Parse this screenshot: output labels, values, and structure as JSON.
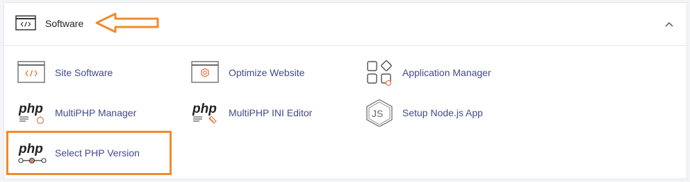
{
  "section": {
    "title": "Software",
    "icons": {
      "header": "code-window-icon",
      "collapse": "chevron-up-icon"
    }
  },
  "items": [
    {
      "label": "Site Software",
      "icon": "code-window-icon"
    },
    {
      "label": "Optimize Website",
      "icon": "gear-window-icon"
    },
    {
      "label": "Application Manager",
      "icon": "apps-grid-icon"
    },
    {
      "label": "MultiPHP Manager",
      "icon": "php-gear-icon"
    },
    {
      "label": "MultiPHP INI Editor",
      "icon": "php-editor-icon"
    },
    {
      "label": "Setup Node.js App",
      "icon": "nodejs-hexagon-icon"
    },
    {
      "label": "Select PHP Version",
      "icon": "php-slider-icon"
    }
  ],
  "colors": {
    "link": "#3f4a8a",
    "accent": "#f08a2b",
    "icon_orange": "#e46b2f"
  }
}
